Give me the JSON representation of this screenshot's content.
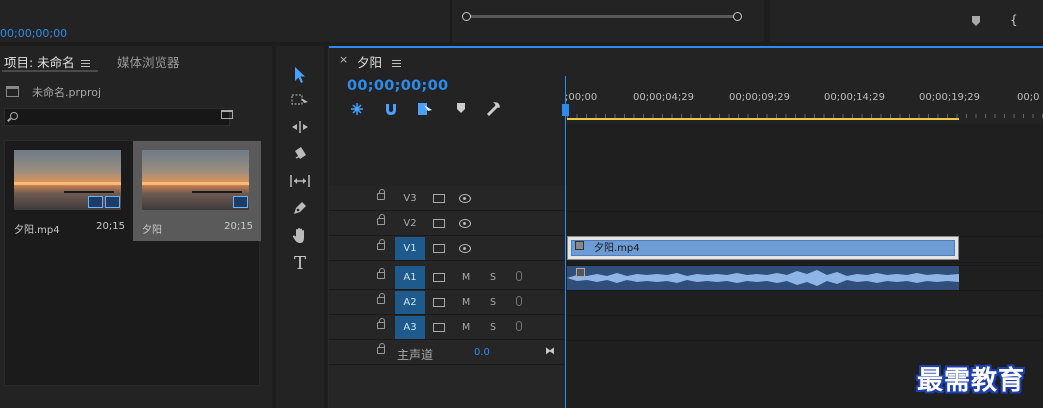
{
  "top": {
    "timecode": "00;00;00;00"
  },
  "project": {
    "tab_project": "项目: 未命名",
    "tab_media": "媒体浏览器",
    "file": "未命名.prproj",
    "search_placeholder": "",
    "items": [
      {
        "name": "夕阳.mp4",
        "duration": "20;15"
      },
      {
        "name": "夕阳",
        "duration": "20;15"
      }
    ]
  },
  "timeline": {
    "title": "夕阳",
    "timecode": "00;00;00;00",
    "ruler": [
      ";00;00",
      "00;00;04;29",
      "00;00;09;29",
      "00;00;14;29",
      "00;00;19;29",
      "00;0"
    ],
    "video_tracks": [
      "V3",
      "V2",
      "V1"
    ],
    "audio_tracks": [
      "A1",
      "A2",
      "A3"
    ],
    "m_label": "M",
    "s_label": "S",
    "master_label": "主声道",
    "master_value": "0.0",
    "video_clip": "夕阳.mp4"
  },
  "watermark": "最需教育",
  "colors": {
    "accent": "#2d8ceb",
    "track_on": "#1e5a8c",
    "clip_video": "#6d9bd4",
    "clip_audio": "#2f4f7a",
    "work_area": "#e8c94a"
  }
}
